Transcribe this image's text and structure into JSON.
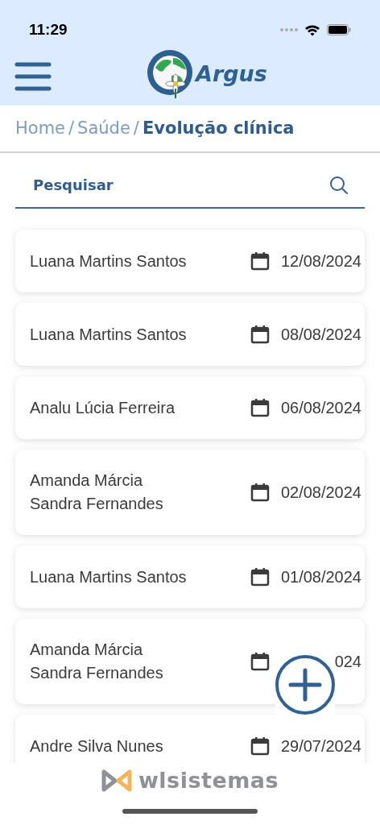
{
  "status_bar": {
    "time": "11:29"
  },
  "header": {
    "logo_text": "Argus"
  },
  "breadcrumb_separator": "/",
  "breadcrumb": [
    {
      "label": "Home",
      "selected": false
    },
    {
      "label": "Saúde",
      "selected": false
    },
    {
      "label": "Evolução clínica",
      "selected": true
    }
  ],
  "search": {
    "placeholder": "Pesquisar"
  },
  "records": [
    {
      "name": "Luana Martins Santos",
      "date": "12/08/2024"
    },
    {
      "name": "Luana Martins Santos",
      "date": "08/08/2024"
    },
    {
      "name": "Analu Lúcia Ferreira",
      "date": "06/08/2024"
    },
    {
      "name": "Amanda Márcia\nSandra Fernandes",
      "date": "02/08/2024"
    },
    {
      "name": "Luana Martins Santos",
      "date": "01/08/2024"
    },
    {
      "name": "Amanda Márcia\nSandra Fernandes",
      "date": "024"
    },
    {
      "name": "Andre Silva Nunes",
      "date": "29/07/2024"
    }
  ],
  "footer": {
    "brand": "wlsistemas"
  }
}
